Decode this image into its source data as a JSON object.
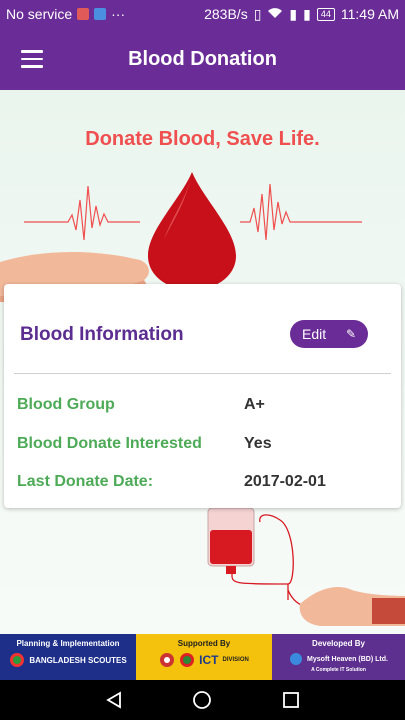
{
  "status_bar": {
    "carrier": "No service",
    "net_speed": "283B/s",
    "battery": "44",
    "time": "11:49 AM"
  },
  "app_bar": {
    "title": "Blood Donation"
  },
  "hero": {
    "slogan": "Donate Blood, Save Life."
  },
  "card": {
    "title": "Blood Information",
    "edit_label": "Edit",
    "rows": [
      {
        "label": "Blood Group",
        "value": "A+"
      },
      {
        "label": "Blood Donate Interested",
        "value": "Yes"
      },
      {
        "label": "Last Donate Date:",
        "value": "2017-02-01"
      }
    ]
  },
  "footer": {
    "planning_title": "Planning & Implementation",
    "scouts_name": "BANGLADESH SCOUTES",
    "supported_title": "Supported By",
    "ict_label": "ICT",
    "ict_sub": "DIVISION",
    "developed_title": "Developed By",
    "developer_name": "Mysoft Heaven (BD) Ltd.",
    "developer_tagline": "A Complete IT Solution"
  },
  "colors": {
    "primary": "#6a2c96",
    "accent_red": "#ef4f4f",
    "label_green": "#4daa57"
  }
}
